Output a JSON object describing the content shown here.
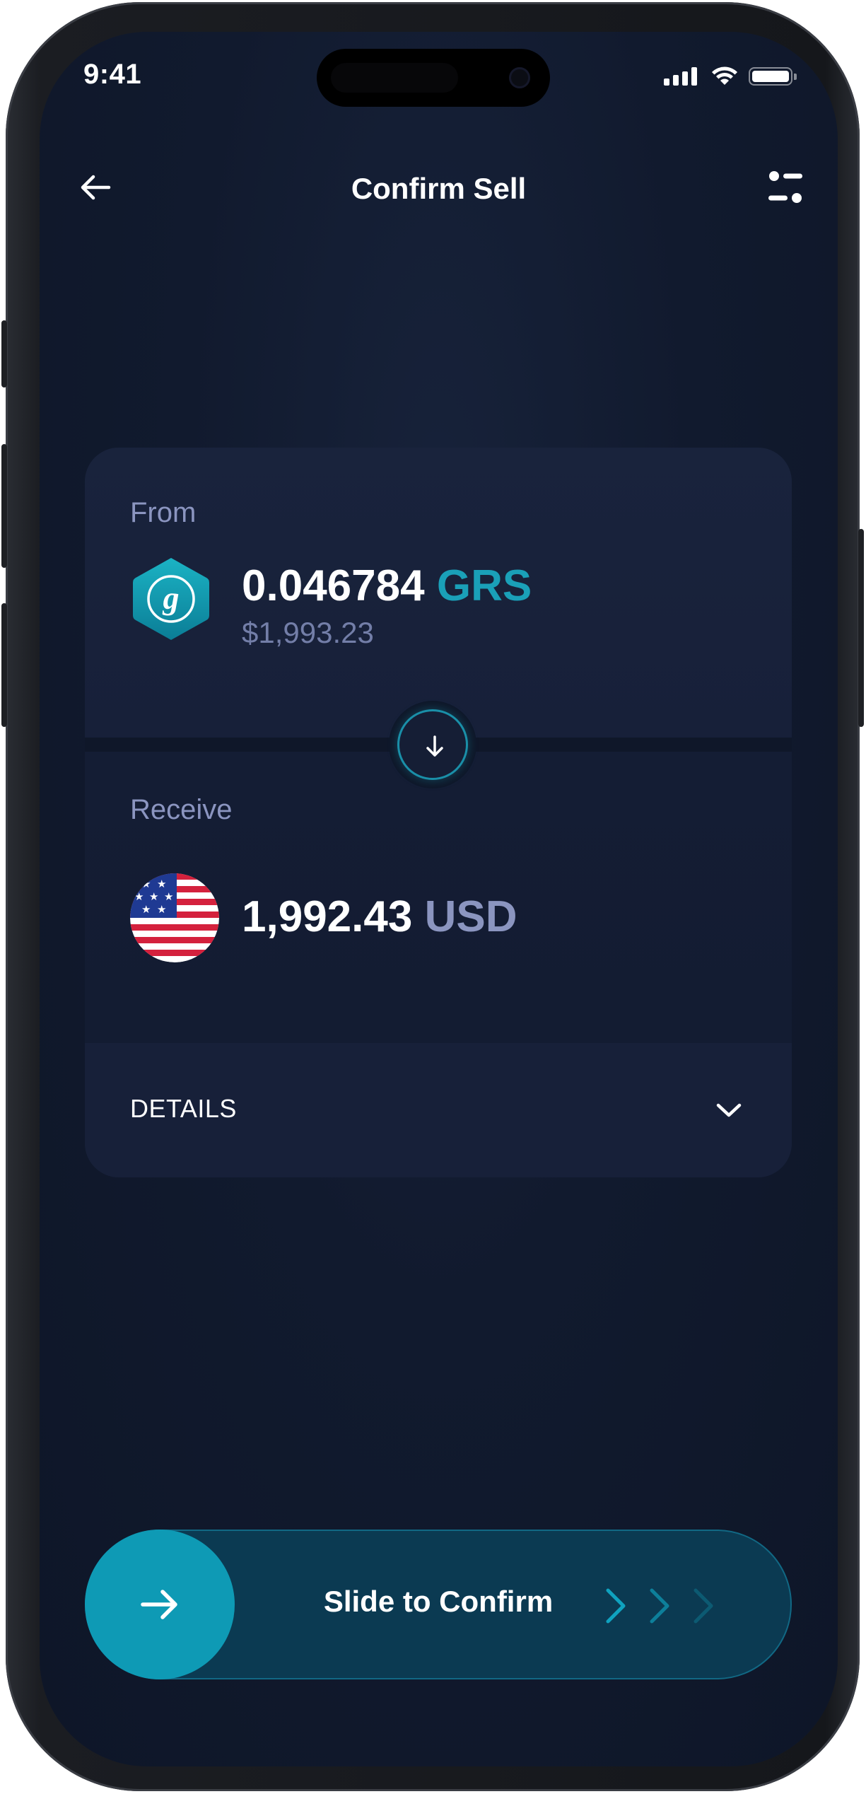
{
  "status_bar": {
    "time": "9:41"
  },
  "nav": {
    "title": "Confirm Sell"
  },
  "from": {
    "label": "From",
    "amount": "0.046784",
    "ticker": "GRS",
    "fiat_value": "$1,993.23",
    "coin_icon": "groestlcoin-icon",
    "accent_color": "#1aa0b8"
  },
  "receive": {
    "label": "Receive",
    "amount": "1,992.43",
    "ticker": "USD",
    "flag_icon": "us-flag-icon"
  },
  "details": {
    "label": "DETAILS",
    "expanded": false
  },
  "slider": {
    "label": "Slide to Confirm",
    "accent_color": "#0e9ab5"
  }
}
